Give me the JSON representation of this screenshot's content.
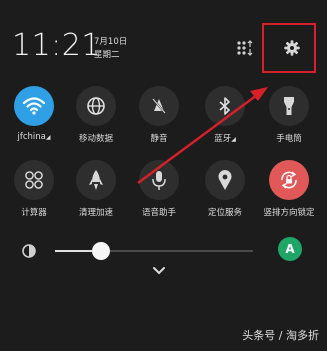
{
  "status": {
    "time": "11:21",
    "date": "7月10日",
    "weekday": "星期二"
  },
  "header": {
    "edit_icon": "edit-grid-icon",
    "settings_icon": "gear-icon"
  },
  "tiles": [
    {
      "label": "jfchina",
      "icon": "wifi-icon",
      "active": true,
      "has_expand": true
    },
    {
      "label": "移动数据",
      "icon": "globe-icon",
      "active": false
    },
    {
      "label": "静音",
      "icon": "mute-bell-icon",
      "active": false
    },
    {
      "label": "蓝牙",
      "icon": "bluetooth-icon",
      "active": false,
      "has_expand": true
    },
    {
      "label": "手电筒",
      "icon": "flashlight-icon",
      "active": false
    },
    {
      "label": "计算器",
      "icon": "calculator-icon",
      "active": false
    },
    {
      "label": "清理加速",
      "icon": "rocket-icon",
      "active": false
    },
    {
      "label": "语音助手",
      "icon": "microphone-icon",
      "active": false
    },
    {
      "label": "定位服务",
      "icon": "location-icon",
      "active": false
    },
    {
      "label": "竖排方向锁定",
      "icon": "rotation-lock-icon",
      "active": true
    }
  ],
  "brightness": {
    "level": 0.23,
    "auto_label": "A"
  },
  "colors": {
    "wifi_active": "#2f9fe6",
    "rotation_active": "#e05858",
    "auto_button": "#1ea567",
    "annotation": "#d8202a"
  },
  "watermark": "头条号 / 淘多折"
}
